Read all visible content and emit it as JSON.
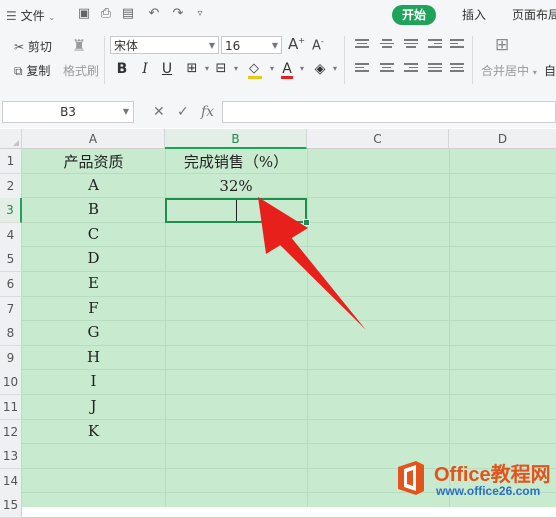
{
  "topbar": {
    "file_menu": "文件",
    "tabs": [
      {
        "label": "开始",
        "active": true
      },
      {
        "label": "插入"
      },
      {
        "label": "页面布局"
      }
    ]
  },
  "ribbon": {
    "cut": "剪切",
    "copy": "复制",
    "format_painter": "格式刷",
    "font_name": "宋体",
    "font_size": "16",
    "merge_center": "合并居中",
    "auto_wrap": "自"
  },
  "formula_bar": {
    "name_box": "B3",
    "fx": "fx",
    "formula": ""
  },
  "sheet": {
    "columns": [
      "A",
      "B",
      "C",
      "D"
    ],
    "selected_column": "B",
    "rows": [
      "1",
      "2",
      "3",
      "4",
      "5",
      "6",
      "7",
      "8",
      "9",
      "10",
      "11",
      "12",
      "13",
      "14",
      "15"
    ],
    "selected_row": "3",
    "cells": {
      "A1": "产品资质",
      "B1": "完成销售（%）",
      "B2": "32%",
      "A2": "A",
      "A3": "B",
      "A4": "C",
      "A5": "D",
      "A6": "E",
      "A7": "F",
      "A8": "G",
      "A9": "H",
      "A10": "I",
      "A11": "J",
      "A12": "K"
    }
  },
  "watermark": {
    "title": "Office教程网",
    "url": "www.office26.com"
  },
  "colors": {
    "accent": "#1fa35a",
    "sheet_bg": "#c8ebd0",
    "arrow": "#e8201c"
  }
}
